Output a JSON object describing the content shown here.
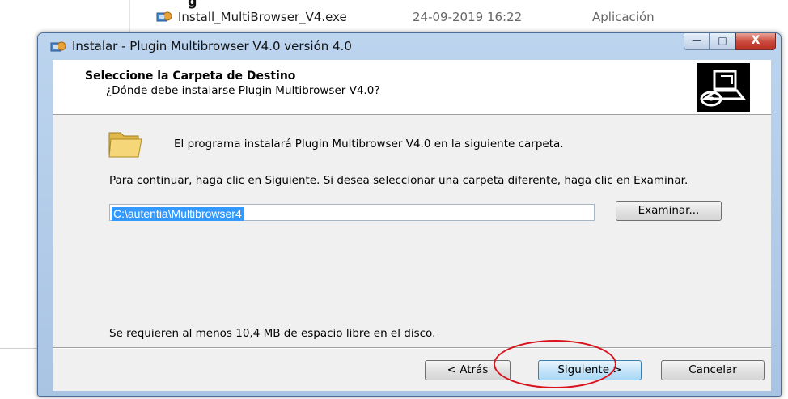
{
  "background": {
    "partial_heading": "g",
    "file": {
      "name": "Install_MultiBrowser_V4.exe",
      "date": "24-09-2019 16:22",
      "type": "Aplicación"
    }
  },
  "dialog": {
    "title": "Instalar - Plugin Multibrowser V4.0 versión 4.0",
    "titlebar_buttons": {
      "minimize_glyph": "—",
      "maximize_glyph": "□",
      "close_glyph": "X"
    },
    "header": {
      "title": "Seleccione la Carpeta de Destino",
      "subtitle": "¿Dónde debe instalarse Plugin Multibrowser V4.0?"
    },
    "body": {
      "message": "El programa instalará Plugin Multibrowser V4.0 en la siguiente carpeta.",
      "instructions": "Para continuar, haga clic en Siguiente. Si desea seleccionar una carpeta diferente, haga clic en Examinar.",
      "path_value": "C:\\autentia\\Multibrowser4",
      "browse_label": "Examinar...",
      "space_message": "Se requieren al menos 10,4 MB de espacio libre en el disco."
    },
    "footer": {
      "back_label": "< Atrás",
      "next_label": "Siguiente >",
      "cancel_label": "Cancelar"
    }
  },
  "colors": {
    "selection": "#3399ff",
    "highlight_ring": "#d9121c",
    "titlebar": "#bcd4ee"
  },
  "icons": [
    "installer-app-icon",
    "folder-icon",
    "computer-cd-icon"
  ]
}
